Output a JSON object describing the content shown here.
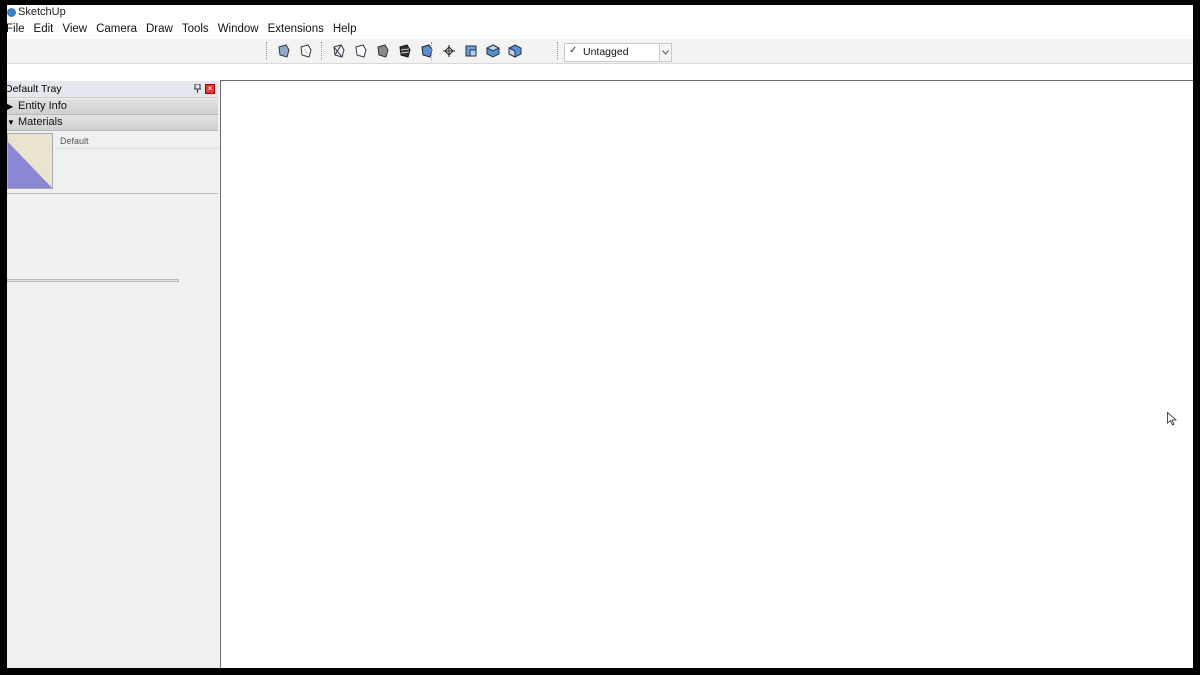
{
  "window": {
    "title": "SketchUp"
  },
  "menu": {
    "items": [
      "File",
      "Edit",
      "View",
      "Camera",
      "Draw",
      "Tools",
      "Window",
      "Extensions",
      "Help"
    ]
  },
  "toolbar": {
    "style_icons": [
      "xray-icon",
      "back-edges-icon",
      "wireframe-icon",
      "hidden-line-icon",
      "shaded-icon",
      "shaded-with-textures-icon",
      "monochrome-icon"
    ],
    "view_icons": [
      "orbit-axes-icon",
      "iso-view-icon",
      "top-view-icon",
      "front-view-icon"
    ],
    "tag_selector": {
      "value": "Untagged",
      "check": "✓"
    }
  },
  "tray": {
    "title": "Default Tray",
    "panels": [
      {
        "label": "Entity Info",
        "expanded": false,
        "marker": "▶"
      },
      {
        "label": "Materials",
        "expanded": true,
        "marker": "▼"
      }
    ],
    "material": {
      "name": "Default",
      "colors": {
        "face": "#e8e4d0",
        "back": "#8b87d6"
      }
    }
  }
}
